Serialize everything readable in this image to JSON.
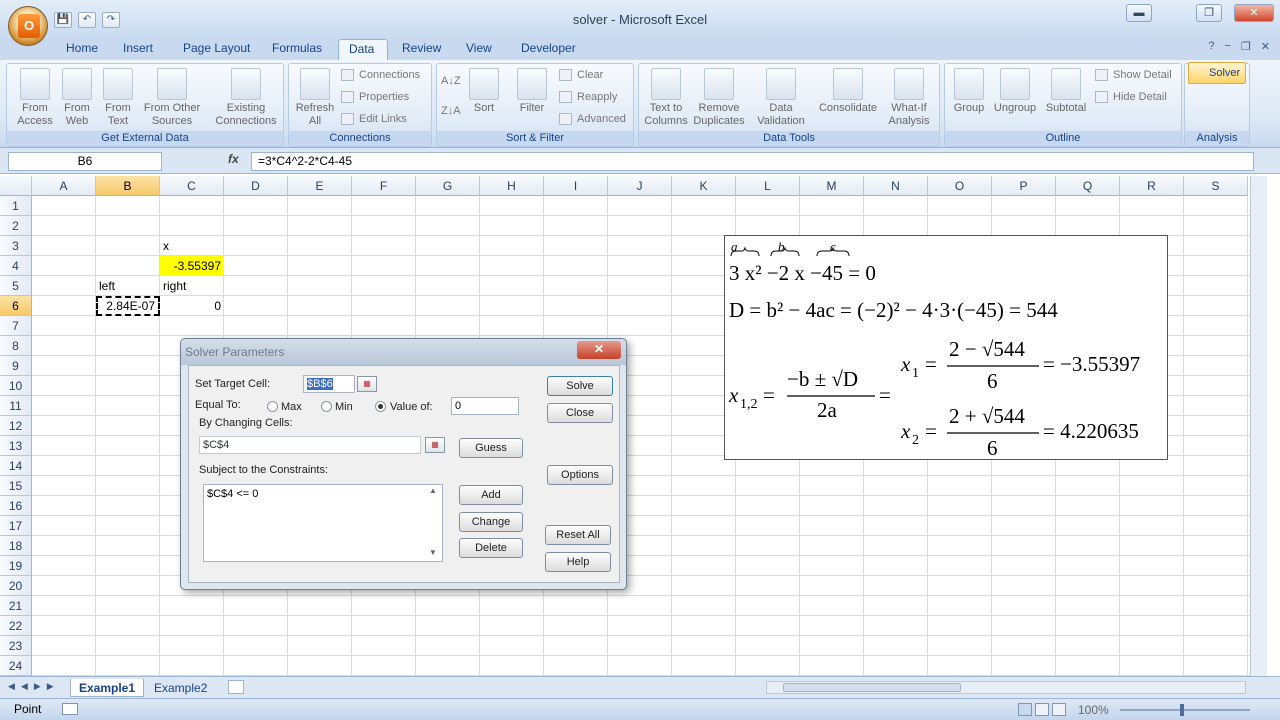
{
  "window": {
    "title": "solver - Microsoft Excel",
    "minimize": "▬",
    "restore": "❐",
    "close": "✕"
  },
  "qat": {
    "save": "💾",
    "undo": "↶",
    "redo": "↷"
  },
  "office_button": "O",
  "tabs": [
    "Home",
    "Insert",
    "Page Layout",
    "Formulas",
    "Data",
    "Review",
    "View",
    "Developer"
  ],
  "active_tab": "Data",
  "ribbon_ctrl": {
    "help": "?",
    "min": "−",
    "restore": "❐",
    "close": "✕"
  },
  "ribbon": {
    "get_external": {
      "label": "Get External Data",
      "from_access": "From Access",
      "from_web": "From Web",
      "from_text": "From Text",
      "from_other": "From Other Sources",
      "existing": "Existing Connections"
    },
    "connections": {
      "label": "Connections",
      "refresh": "Refresh All",
      "connections": "Connections",
      "properties": "Properties",
      "edit_links": "Edit Links"
    },
    "sort_filter": {
      "label": "Sort & Filter",
      "sort": "Sort",
      "filter": "Filter",
      "clear": "Clear",
      "reapply": "Reapply",
      "advanced": "Advanced",
      "az": "A↓Z",
      "za": "Z↓A"
    },
    "data_tools": {
      "label": "Data Tools",
      "text_to_columns": "Text to Columns",
      "remove_duplicates": "Remove Duplicates",
      "data_validation": "Data Validation",
      "consolidate": "Consolidate",
      "what_if": "What-If Analysis"
    },
    "outline": {
      "label": "Outline",
      "group": "Group",
      "ungroup": "Ungroup",
      "subtotal": "Subtotal",
      "show_detail": "Show Detail",
      "hide_detail": "Hide Detail"
    },
    "analysis": {
      "label": "Analysis",
      "solver": "Solver"
    }
  },
  "formula_bar": {
    "name_box": "B6",
    "fx": "fx",
    "formula": "=3*C4^2-2*C4-45"
  },
  "columns": [
    "A",
    "B",
    "C",
    "D",
    "E",
    "F",
    "G",
    "H",
    "I",
    "J",
    "K",
    "L",
    "M",
    "N",
    "O",
    "P",
    "Q",
    "R",
    "S"
  ],
  "selected_column": "B",
  "rows": [
    "1",
    "2",
    "3",
    "4",
    "5",
    "6",
    "7",
    "8",
    "9",
    "10",
    "11",
    "12",
    "13",
    "14",
    "15",
    "16",
    "17",
    "18",
    "19",
    "20",
    "21",
    "22",
    "23",
    "24"
  ],
  "selected_row": "6",
  "cells": {
    "C3": "x",
    "C4": "-3.55397",
    "B5": "left",
    "C5": "right",
    "B6": "2.84E-07",
    "C6": "0"
  },
  "equations": {
    "brace_a": "a",
    "brace_b": "b",
    "brace_c": "c",
    "line1": "3 x² −2 x −45 = 0",
    "line2": "D = b² − 4ac = (−2)² − 4·3·(−45) = 544",
    "x12_lhs": "x",
    "x12_sub": "1,2",
    "x12_num": "−b ± √D",
    "x12_den": "2a",
    "x1_num": "2 − √544",
    "x1_den": "6",
    "x1_val": "= −3.55397",
    "x2_num": "2 + √544",
    "x2_den": "6",
    "x2_val": "= 4.220635",
    "eq": "=",
    "sub1": "1",
    "sub2": "2"
  },
  "dialog": {
    "title": "Solver Parameters",
    "close": "✕",
    "set_target_label": "Set Target Cell:",
    "set_target_value": "$B$6",
    "equal_to_label": "Equal To:",
    "max": "Max",
    "min": "Min",
    "value_of": "Value of:",
    "value": "0",
    "changing_label": "By Changing Cells:",
    "changing_value": "$C$4",
    "constraints_label": "Subject to the Constraints:",
    "constraints": [
      "$C$4 <= 0"
    ],
    "solve": "Solve",
    "close_btn": "Close",
    "guess": "Guess",
    "options": "Options",
    "add": "Add",
    "change": "Change",
    "delete": "Delete",
    "reset_all": "Reset All",
    "help": "Help"
  },
  "sheets": [
    "Example1",
    "Example2"
  ],
  "active_sheet": "Example1",
  "status": {
    "mode": "Point",
    "zoom": "100%"
  }
}
